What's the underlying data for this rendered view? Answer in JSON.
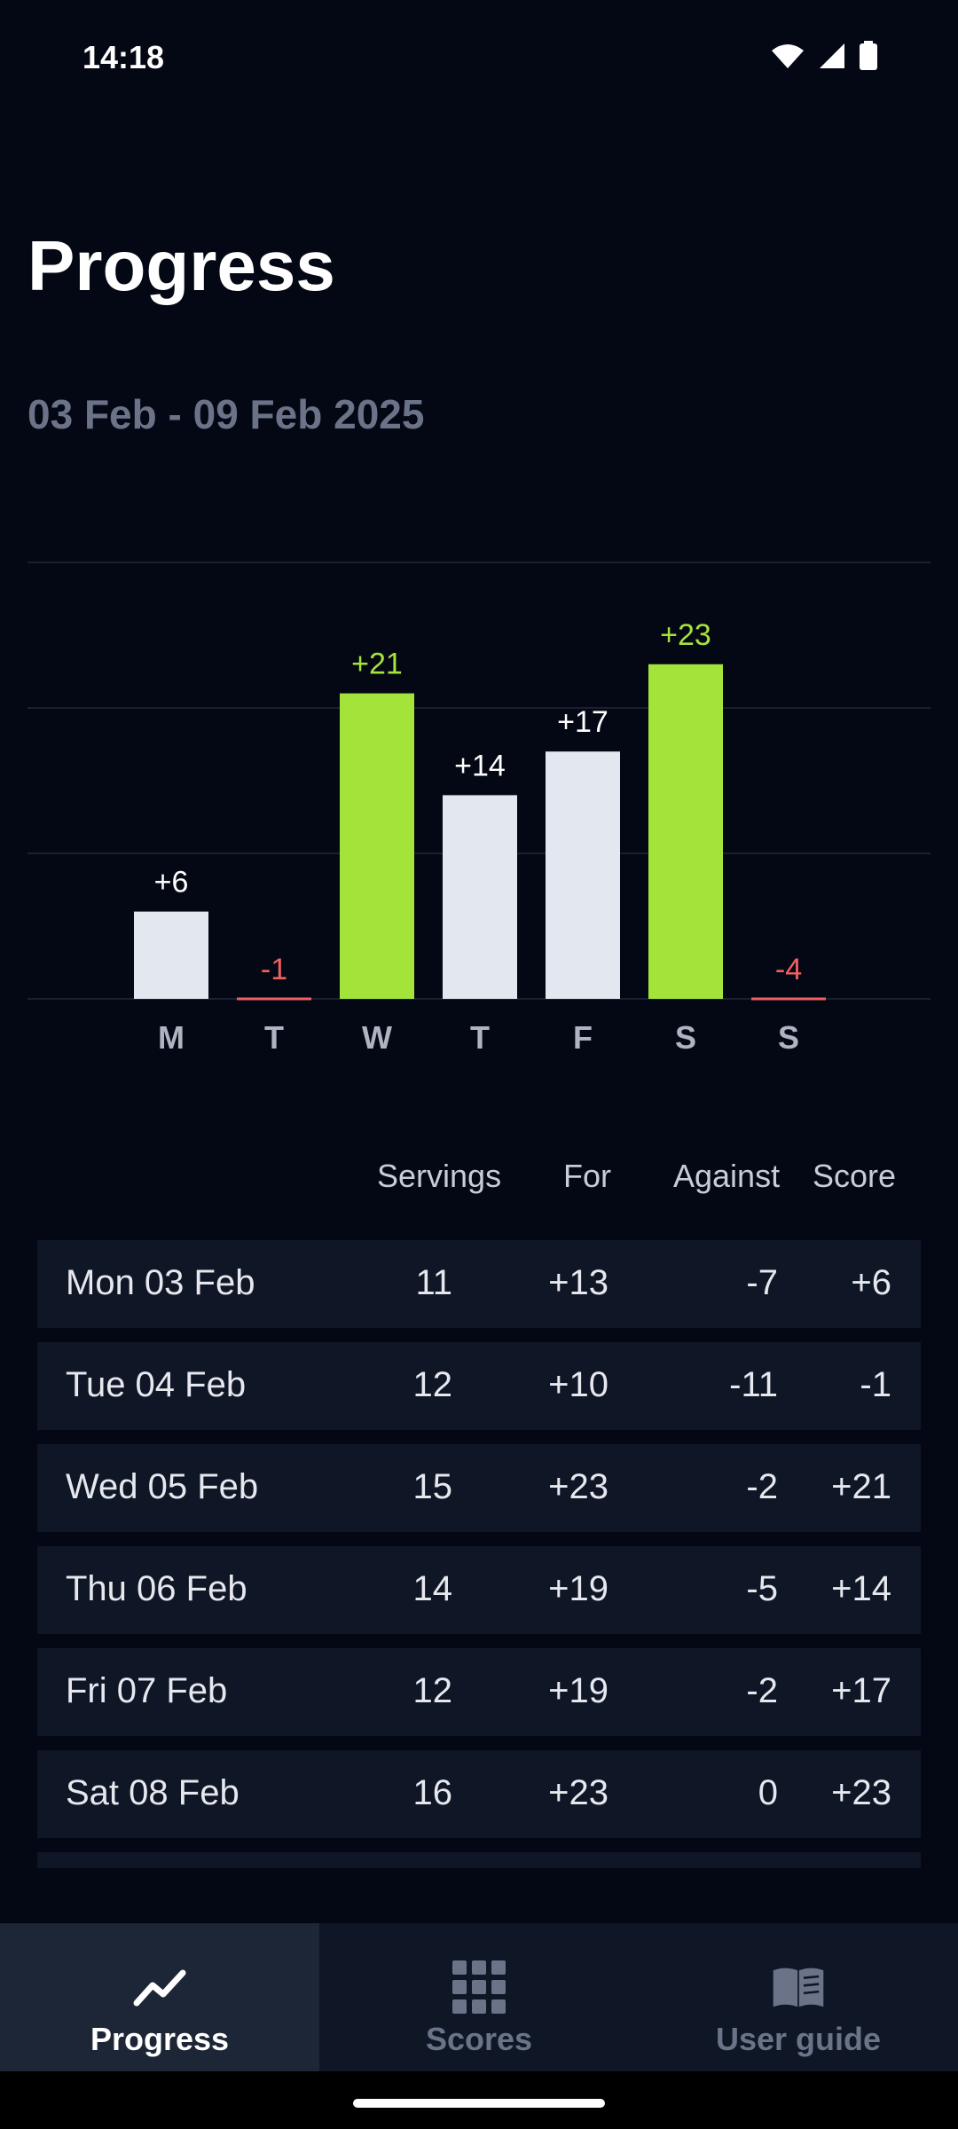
{
  "status_bar": {
    "time": "14:18"
  },
  "page": {
    "title": "Progress",
    "date_range": "03 Feb - 09 Feb 2025"
  },
  "colors": {
    "background": "#040814",
    "bar_default": "#e3e7ef",
    "bar_highlight": "#a4e43a",
    "negative": "#f06060",
    "muted_text": "#6b7388",
    "row_background": "#0f1626",
    "nav_active_background": "#1d2636"
  },
  "chart_data": {
    "type": "bar",
    "categories": [
      "M",
      "T",
      "W",
      "T",
      "F",
      "S",
      "S"
    ],
    "values": [
      6,
      -1,
      21,
      14,
      17,
      23,
      -4
    ],
    "value_labels": [
      "+6",
      "-1",
      "+21",
      "+14",
      "+17",
      "+23",
      "-4"
    ],
    "highlighted": [
      false,
      false,
      true,
      false,
      false,
      true,
      false
    ],
    "ylim": [
      0,
      30
    ],
    "gridlines": [
      0,
      10,
      20,
      30
    ],
    "grid": true,
    "title": "",
    "xlabel": "",
    "ylabel": ""
  },
  "table": {
    "headers": [
      "Servings",
      "For",
      "Against",
      "Score"
    ],
    "rows": [
      {
        "date": "Mon 03 Feb",
        "servings": "11",
        "for": "+13",
        "against": "-7",
        "score": "+6"
      },
      {
        "date": "Tue 04 Feb",
        "servings": "12",
        "for": "+10",
        "against": "-11",
        "score": "-1"
      },
      {
        "date": "Wed 05 Feb",
        "servings": "15",
        "for": "+23",
        "against": "-2",
        "score": "+21"
      },
      {
        "date": "Thu 06 Feb",
        "servings": "14",
        "for": "+19",
        "against": "-5",
        "score": "+14"
      },
      {
        "date": "Fri 07 Feb",
        "servings": "12",
        "for": "+19",
        "against": "-2",
        "score": "+17"
      },
      {
        "date": "Sat 08 Feb",
        "servings": "16",
        "for": "+23",
        "against": "0",
        "score": "+23"
      }
    ]
  },
  "nav": {
    "items": [
      {
        "label": "Progress",
        "icon": "trend-line-icon",
        "active": true
      },
      {
        "label": "Scores",
        "icon": "grid-icon",
        "active": false
      },
      {
        "label": "User guide",
        "icon": "book-icon",
        "active": false
      }
    ]
  }
}
